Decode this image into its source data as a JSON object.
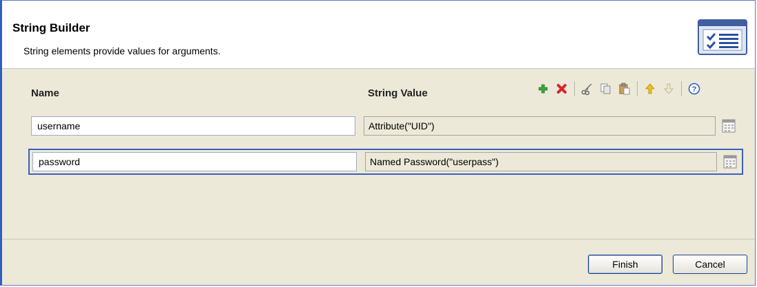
{
  "header": {
    "title": "String Builder",
    "subtitle": "String elements provide values for arguments."
  },
  "columns": {
    "name": "Name",
    "value": "String Value"
  },
  "toolbar": {
    "icons": [
      "add-icon",
      "delete-icon",
      "cut-icon",
      "copy-icon",
      "paste-icon",
      "move-up-icon",
      "move-down-icon",
      "help-icon"
    ],
    "colors": {
      "add": "#3aa53a",
      "delete": "#d8242a",
      "arrow_up": "#e0a800",
      "help": "#2a59c4"
    }
  },
  "rows": [
    {
      "name": "username",
      "value": "Attribute(\"UID\")",
      "selected": false
    },
    {
      "name": "password",
      "value": "Named Password(\"userpass\")",
      "selected": true
    }
  ],
  "footer": {
    "finish_label": "Finish",
    "cancel_label": "Cancel"
  }
}
